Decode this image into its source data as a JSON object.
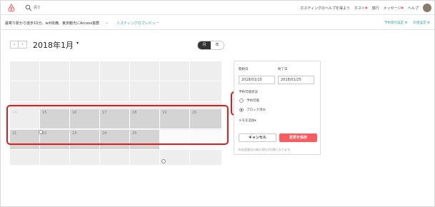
{
  "topnav": {
    "search_placeholder": "探す",
    "links": [
      "ホスティングのヘルプを得よう",
      "ホスト",
      "旅行",
      "メッセージ",
      "ヘルプ"
    ]
  },
  "subnav": {
    "listing_title": "最寄り駅から徒歩10分、wifi完備、東京観光にAccess抜群",
    "preview_link": "リスティングのプレビュー",
    "right_links": [
      "予約受付設定",
      "料金設定"
    ]
  },
  "calendar": {
    "month_title": "2018年1月",
    "view_month": "月",
    "view_year": "年",
    "rows": [
      [
        "",
        "",
        "",
        "",
        "",
        "",
        ""
      ],
      [
        "",
        "",
        "",
        "",
        "",
        "",
        ""
      ],
      [
        "14",
        "15",
        "16",
        "17",
        "18",
        "19",
        "20"
      ],
      [
        "21",
        "22",
        "23",
        "24",
        "25",
        "",
        ""
      ],
      [
        "",
        "",
        "",
        "",
        "",
        "",
        ""
      ]
    ]
  },
  "panel": {
    "start_label": "開始日",
    "end_label": "終了日",
    "start_value": "2018/01/15",
    "end_value": "2018/01/25",
    "availability_label": "予約可能状況",
    "option_available": "予約可能",
    "option_blocked": "ブロック済み",
    "memo_link": "メモを追加",
    "cancel": "キャンセル",
    "save": "変更を保存",
    "note": "料金変更は以後の滞在が対象となります。"
  },
  "colors": {
    "brand": "#ff5a5f",
    "annotation_red": "#e5191b",
    "link": "#3a9ea5"
  }
}
